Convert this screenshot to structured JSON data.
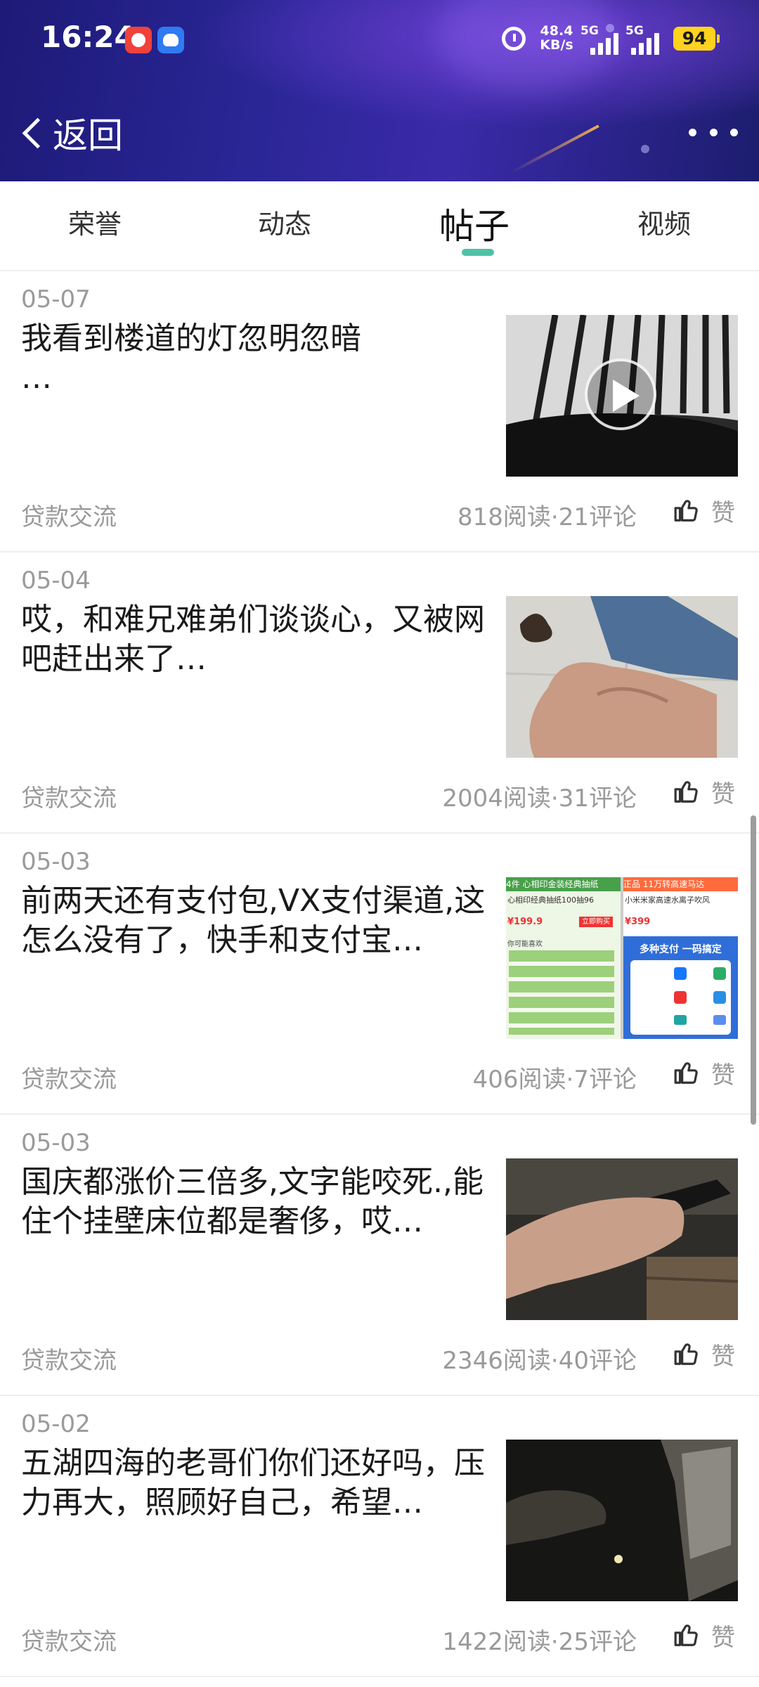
{
  "status_bar": {
    "time": "16:24",
    "net_speed_value": "48.4",
    "net_speed_unit": "KB/s",
    "signal1_label": "5G",
    "signal2_label": "5G",
    "battery": "94",
    "battery_color": "#ffd21f"
  },
  "nav": {
    "back_label": "返回",
    "back_icon": "chevron-left-icon",
    "more_icon": "more-dots-icon"
  },
  "tabs": [
    {
      "label": "荣誉",
      "active": false
    },
    {
      "label": "动态",
      "active": false
    },
    {
      "label": "帖子",
      "active": true
    },
    {
      "label": "视频",
      "active": false
    }
  ],
  "accent_color": "#4fc1a6",
  "posts": [
    {
      "date": "05-07",
      "text": "我看到楼道的灯忽明忽暗\n…",
      "category": "贷款交流",
      "stats": "818阅读·21评论",
      "like_label": "赞",
      "has_video": true
    },
    {
      "date": "05-04",
      "text": "哎，和难兄难弟们谈谈心，又被网吧赶出来了…",
      "category": "贷款交流",
      "stats": "2004阅读·31评论",
      "like_label": "赞",
      "has_video": false
    },
    {
      "date": "05-03",
      "text": "前两天还有支付包,VX支付渠道,这怎么没有了，快手和支付宝…",
      "category": "贷款交流",
      "stats": "406阅读·7评论",
      "like_label": "赞",
      "has_video": false
    },
    {
      "date": "05-03",
      "text": "国庆都涨价三倍多,文字能咬死.,能住个挂壁床位都是奢侈，哎…",
      "category": "贷款交流",
      "stats": "2346阅读·40评论",
      "like_label": "赞",
      "has_video": false
    },
    {
      "date": "05-02",
      "text": "五湖四海的老哥们你们还好吗，压力再大，照顾好自己，希望…",
      "category": "贷款交流",
      "stats": "1422阅读·25评论",
      "like_label": "赞",
      "has_video": false
    }
  ],
  "thumb3": {
    "tl_badge": "4件",
    "tl_title": "心相印金装经典抽纸",
    "tl_sub": "心相印经典抽纸100抽96",
    "tl_price": "¥199.9",
    "tl_btn": "立即购买",
    "tl_tag": "你可能喜欢",
    "tr_badge": "正品",
    "tr_top": "11万转高速马达",
    "tr_sub": "小米米家高速水离子吹风",
    "tr_price": "¥399",
    "tr_headline": "多种支付 一码搞定"
  }
}
